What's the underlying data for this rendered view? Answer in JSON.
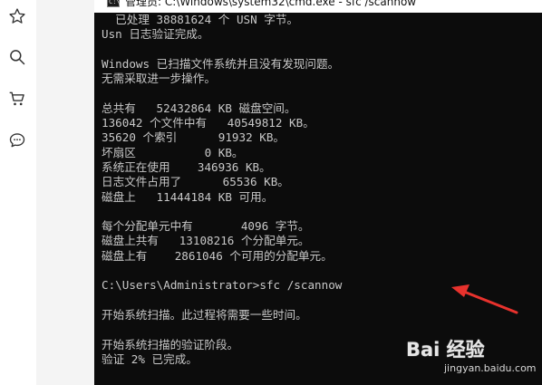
{
  "window": {
    "title": "管理员: C:\\Windows\\system32\\cmd.exe - sfc  /scannow",
    "icon_label": "C:\\"
  },
  "console_lines": [
    "  已处理 38881624 个 USN 字节。",
    "Usn 日志验证完成。",
    "",
    "Windows 已扫描文件系统并且没有发现问题。",
    "无需采取进一步操作。",
    "",
    "总共有   52432864 KB 磁盘空间。",
    "136042 个文件中有   40549812 KB。",
    "35620 个索引      91932 KB。",
    "坏扇区          0 KB。",
    "系统正在使用    346936 KB。",
    "日志文件占用了      65536 KB。",
    "磁盘上   11444184 KB 可用。",
    "",
    "每个分配单元中有       4096 字节。",
    "磁盘上共有   13108216 个分配单元。",
    "磁盘上有    2861046 个可用的分配单元。",
    "",
    "C:\\Users\\Administrator>sfc /scannow",
    "",
    "开始系统扫描。此过程将需要一些时间。",
    "",
    "开始系统扫描的验证阶段。",
    "验证 2% 已完成。"
  ],
  "sidebar": {
    "icons": [
      "star-icon",
      "search-icon",
      "cart-icon",
      "comment-icon"
    ]
  },
  "watermark": {
    "brand": "Bai 经验",
    "url": "jingyan.baidu.com"
  },
  "colors": {
    "console_bg": "#0c0c0c",
    "console_text": "#c8c8c8",
    "arrow": "#e8322d"
  }
}
